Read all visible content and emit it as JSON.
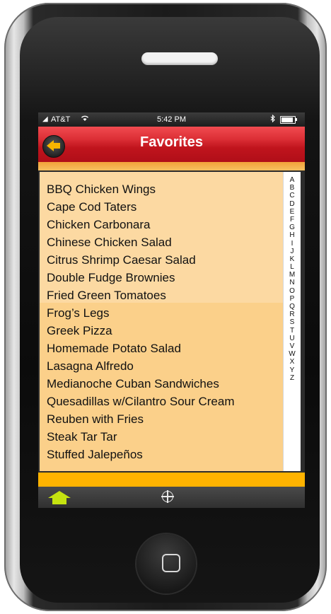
{
  "status_bar": {
    "carrier": "AT&T",
    "time": "5:42 PM"
  },
  "header": {
    "title": "Favorites"
  },
  "favorites": [
    "BBQ Chicken Wings",
    "Cape Cod Taters",
    "Chicken Carbonara",
    "Chinese Chicken Salad",
    "Citrus Shrimp Caesar Salad",
    "Double Fudge Brownies",
    "Fried Green Tomatoes",
    "Frog’s Legs",
    "Greek Pizza",
    "Homemade Potato Salad",
    "Lasagna Alfredo",
    "Medianoche Cuban Sandwiches",
    "Quesadillas w/Cilantro Sour Cream",
    "Reuben with Fries",
    "Steak Tar Tar",
    "Stuffed Jalepeños"
  ],
  "alphabet_index": [
    "A",
    "B",
    "C",
    "D",
    "E",
    "F",
    "G",
    "H",
    "I",
    "J",
    "K",
    "L",
    "M",
    "N",
    "O",
    "P",
    "Q",
    "R",
    "S",
    "T",
    "U",
    "V",
    "W",
    "X",
    "Y",
    "Z"
  ],
  "icons": {
    "back": "back-arrow-icon",
    "home": "home-icon",
    "locate": "crosshair-icon",
    "wifi": "wifi-icon",
    "bluetooth": "bluetooth-icon",
    "battery": "battery-icon",
    "signal": "signal-icon"
  },
  "colors": {
    "header_red": "#d12630",
    "list_background": "#fcd9a2",
    "accent_yellow": "#ffb300",
    "home_icon": "#c5e310",
    "back_arrow": "#f7b500"
  }
}
